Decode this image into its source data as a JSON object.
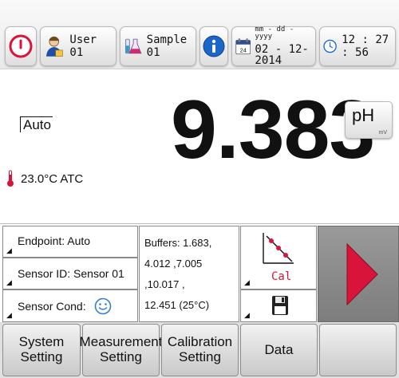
{
  "topbar": {
    "user_label": "User 01",
    "sample_label": "Sample 01",
    "date_format": "mm - dd - yyyy",
    "date_value": "02 - 12-2014",
    "calendar_day": "24",
    "time": "12 : 27 : 56"
  },
  "main": {
    "mode": "Auto",
    "temperature": "23.0°C ATC",
    "reading": "9.383",
    "unit_main": "pH",
    "unit_alt": "mV"
  },
  "info": {
    "endpoint": "Endpoint: Auto",
    "sensor_id": "Sensor ID: Sensor 01",
    "sensor_cond": "Sensor Cond:",
    "buffers_line1": "Buffers:    1.683,",
    "buffers_line2": "4.012 ,7.005 ,10.017 ,",
    "buffers_line3": "12.451 (25°C)",
    "cal_label": "Cal"
  },
  "bottom": {
    "system_line1": "System",
    "system_line2": "Setting",
    "measurement_line1": "Measurement",
    "measurement_line2": "Setting",
    "calibration_line1": "Calibration",
    "calibration_line2": "Setting",
    "data_label": "Data"
  },
  "colors": {
    "accent_red": "#d9143a",
    "info_blue": "#1a66c9",
    "smiley_blue": "#2f7de1"
  }
}
